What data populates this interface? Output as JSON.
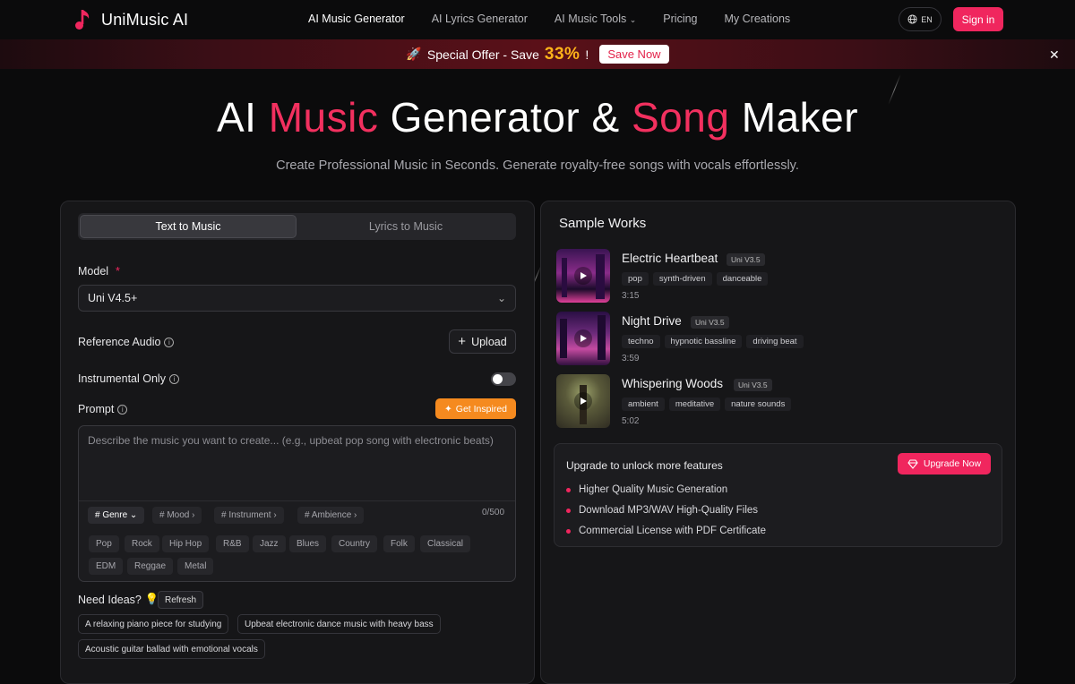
{
  "nav": {
    "logo": "UniMusic AI",
    "links": [
      "AI Music Generator",
      "AI Lyrics Generator",
      "AI Music Tools",
      "Pricing",
      "My Creations"
    ],
    "lang": "EN",
    "signin": "Sign in"
  },
  "banner": {
    "prefix": "Special Offer - Save",
    "percent": "33%",
    "suffix": "!",
    "button": "Save Now"
  },
  "hero": {
    "title_1": "AI",
    "title_2": "Music",
    "title_3": "Generator &",
    "title_4": "Song",
    "title_5": "Maker",
    "subtitle": "Create Professional Music in Seconds. Generate royalty-free songs with vocals effortlessly."
  },
  "form": {
    "tabs": [
      "Text to Music",
      "Lyrics to Music"
    ],
    "model_label": "Model",
    "model_required": "*",
    "model_value": "Uni V4.5+",
    "ref_audio_label": "Reference Audio",
    "upload_label": "Upload",
    "instrumental_label": "Instrumental Only",
    "prompt_label": "Prompt",
    "inspire_label": "Get Inspired",
    "placeholder": "Describe the music you want to create... (e.g., upbeat pop song with electronic beats)",
    "chips": [
      "# Genre",
      "# Mood",
      "# Instrument",
      "# Ambience"
    ],
    "count": "0/500",
    "genres": [
      "Pop",
      "Rock",
      "Hip Hop",
      "R&B",
      "Jazz",
      "Blues",
      "Country",
      "Folk",
      "Classical",
      "EDM",
      "Reggae",
      "Metal"
    ],
    "need_ideas": "Need Ideas?",
    "refresh": "Refresh",
    "ideas": [
      "A relaxing piano piece for studying",
      "Upbeat electronic dance music with heavy bass",
      "Acoustic guitar ballad with emotional vocals"
    ]
  },
  "samples": {
    "title": "Sample Works",
    "items": [
      {
        "title": "Electric Heartbeat",
        "version": "Uni V3.5",
        "tags": [
          "pop",
          "synth-driven",
          "danceable"
        ],
        "duration": "3:15"
      },
      {
        "title": "Night Drive",
        "version": "Uni V3.5",
        "tags": [
          "techno",
          "hypnotic bassline",
          "driving beat"
        ],
        "duration": "3:59"
      },
      {
        "title": "Whispering Woods",
        "version": "Uni V3.5",
        "tags": [
          "ambient",
          "meditative",
          "nature sounds"
        ],
        "duration": "5:02"
      }
    ]
  },
  "upgrade": {
    "title": "Upgrade to unlock more features",
    "button": "Upgrade Now",
    "features": [
      "Higher Quality Music Generation",
      "Download MP3/WAV High-Quality Files",
      "Commercial License with PDF Certificate"
    ]
  },
  "colors": {
    "accent": "#f0265e",
    "orange": "#f58a1f",
    "offer": "#ffb31a"
  }
}
